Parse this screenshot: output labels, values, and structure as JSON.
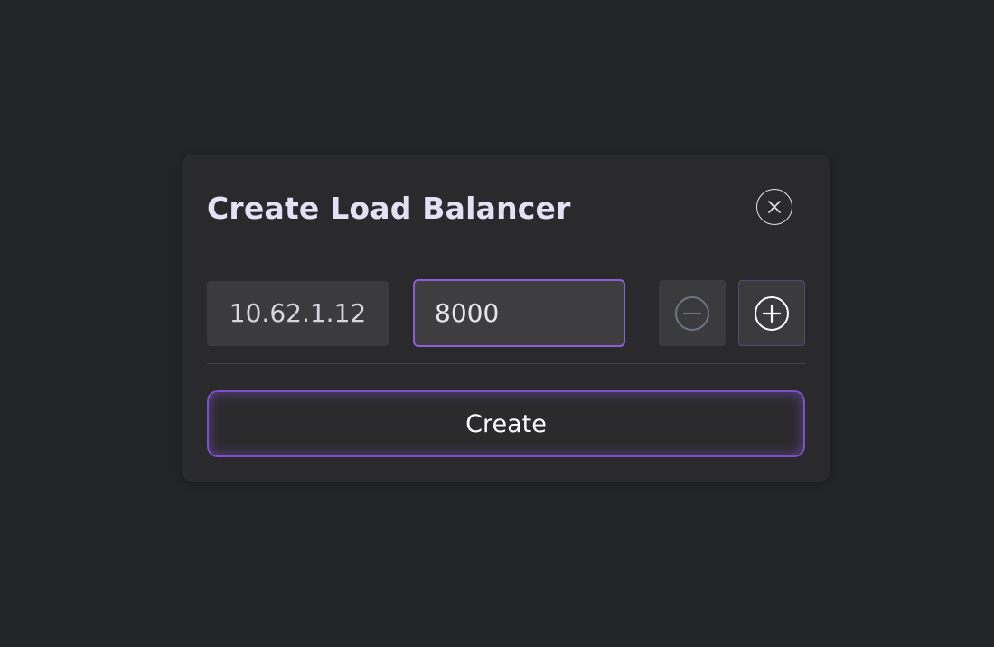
{
  "dialog": {
    "title": "Create Load Balancer",
    "close_icon": "close-circle-x-icon",
    "ip_address": "10.62.1.12",
    "port_value": "8000",
    "decrement_icon": "minus-circle-icon",
    "increment_icon": "plus-circle-icon",
    "decrement_disabled": true,
    "create_label": "Create"
  },
  "colors": {
    "background": "#232427",
    "dialog": "#2a2a2c",
    "accent": "#8e5cd6",
    "title": "#e4e1f6"
  }
}
